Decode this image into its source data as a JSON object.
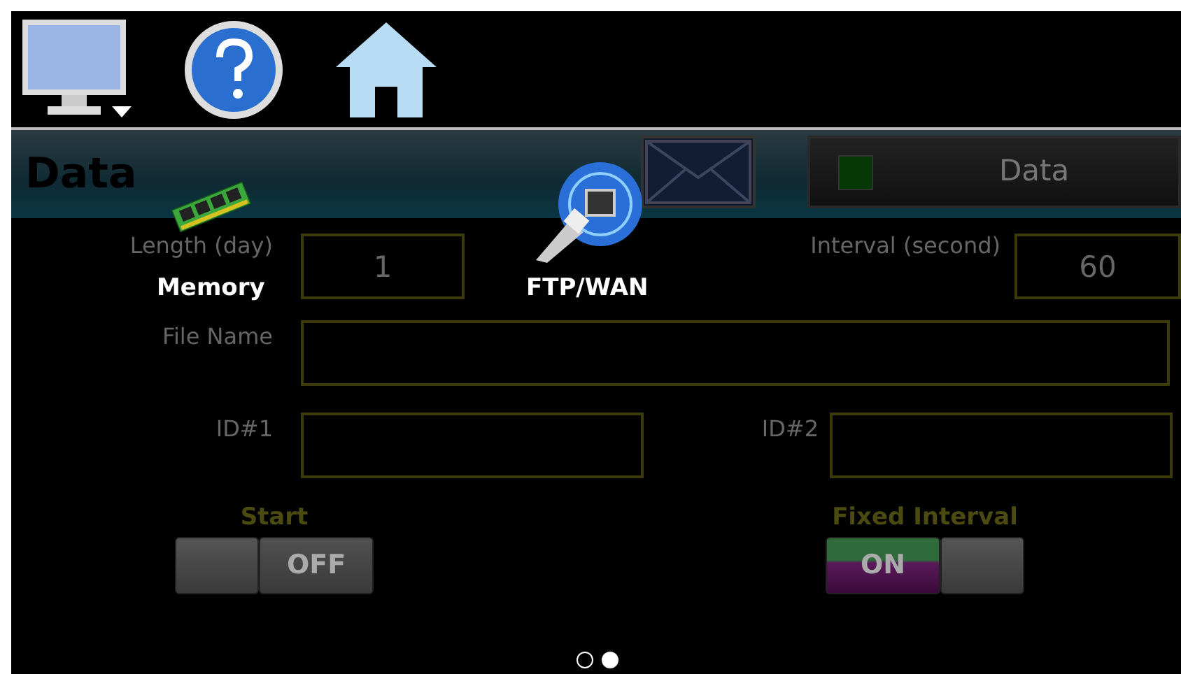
{
  "header": {
    "title": "Data",
    "status_button": {
      "label": "Data",
      "indicator_on": false
    }
  },
  "menu_overlay": {
    "items": [
      {
        "label": "Memory",
        "kind": "memory"
      },
      {
        "label": "FTP/WAN",
        "kind": "network"
      }
    ]
  },
  "fields": [
    {
      "label": "Length (day)",
      "value": "1"
    },
    {
      "label": "Interval (second)",
      "value": "60"
    },
    {
      "label": "File Name"
    },
    {
      "label": "ID#1"
    },
    {
      "label": "ID#2"
    }
  ],
  "toggles": [
    {
      "label": "Start",
      "on": false,
      "state_label": "OFF"
    },
    {
      "label": "Fixed Interval",
      "on": true,
      "state_label": "ON"
    }
  ],
  "pager": [
    {
      "selected": false
    },
    {
      "selected": true
    }
  ]
}
